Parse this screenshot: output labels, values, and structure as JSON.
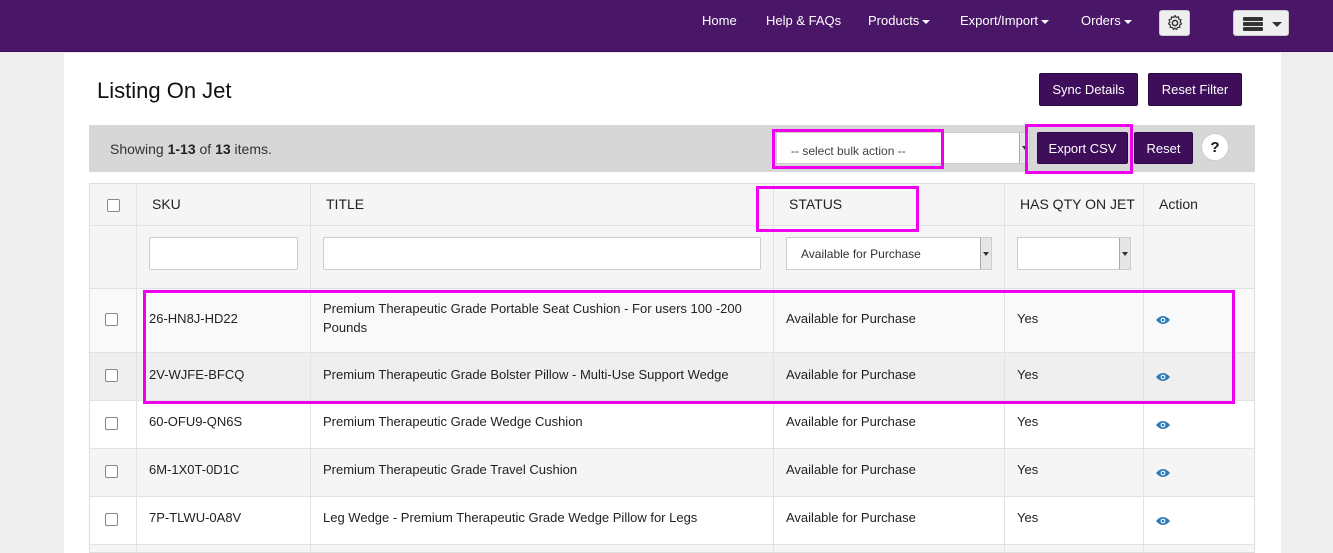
{
  "nav": {
    "home": "Home",
    "help": "Help & FAQs",
    "products": "Products",
    "export_import": "Export/Import",
    "orders": "Orders",
    "settings_icon": "gear-icon",
    "menu_icon": "server-icon"
  },
  "page": {
    "title": "Listing On Jet",
    "sync_details": "Sync Details",
    "reset_filter": "Reset Filter"
  },
  "toolbar": {
    "showing_prefix": "Showing ",
    "range": "1-13",
    "of": " of ",
    "total": "13",
    "items_suffix": " items.",
    "bulk_action_placeholder": "-- select bulk action --",
    "export_csv": "Export CSV",
    "reset": "Reset",
    "help": "?"
  },
  "table": {
    "headers": [
      "SKU",
      "TITLE",
      "STATUS",
      "HAS QTY ON JET",
      "Action"
    ],
    "filters": {
      "status": "Available for Purchase",
      "has_qty": ""
    },
    "rows": [
      {
        "sku": "26-HN8J-HD22",
        "title": "Premium Therapeutic Grade Portable Seat Cushion - For users 100 -200 Pounds",
        "status": "Available for Purchase",
        "has_qty": "Yes"
      },
      {
        "sku": "2V-WJFE-BFCQ",
        "title": "Premium Therapeutic Grade Bolster Pillow - Multi-Use Support Wedge",
        "status": "Available for Purchase",
        "has_qty": "Yes"
      },
      {
        "sku": "60-OFU9-QN6S",
        "title": "Premium Therapeutic Grade Wedge Cushion",
        "status": "Available for Purchase",
        "has_qty": "Yes"
      },
      {
        "sku": "6M-1X0T-0D1C",
        "title": "Premium Therapeutic Grade Travel Cushion",
        "status": "Available for Purchase",
        "has_qty": "Yes"
      },
      {
        "sku": "7P-TLWU-0A8V",
        "title": "Leg Wedge - Premium Therapeutic Grade Wedge Pillow for Legs",
        "status": "Available for Purchase",
        "has_qty": "Yes"
      }
    ]
  },
  "colors": {
    "nav_bg": "#4a1668",
    "button_bg": "#3f0e5a",
    "highlight": "#ee00ee",
    "eye_icon": "#2a7ab8"
  }
}
